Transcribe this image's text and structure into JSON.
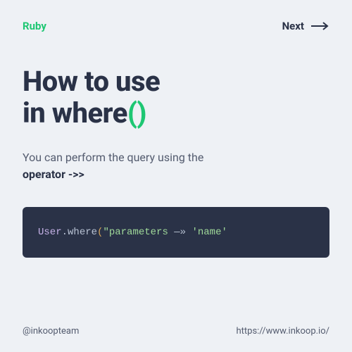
{
  "header": {
    "category": "Ruby",
    "next_label": "Next"
  },
  "title": {
    "line1": "How to use",
    "line2_plain": "in where",
    "line2_accent": "()"
  },
  "description": {
    "text_before": "You can perform the query using the ",
    "bold": "operator ->>"
  },
  "code": {
    "class_name": "User",
    "dot": ".",
    "method": "where",
    "paren_open": "(",
    "string_open": "\"parameters",
    "arrow_glyph": " —» ",
    "string_close": "'name'"
  },
  "footer": {
    "handle": "@inkoopteam",
    "url": "https://www.inkoop.io/"
  },
  "colors": {
    "accent": "#1ec773",
    "dark": "#2a3247",
    "bg": "#eef1f5"
  }
}
